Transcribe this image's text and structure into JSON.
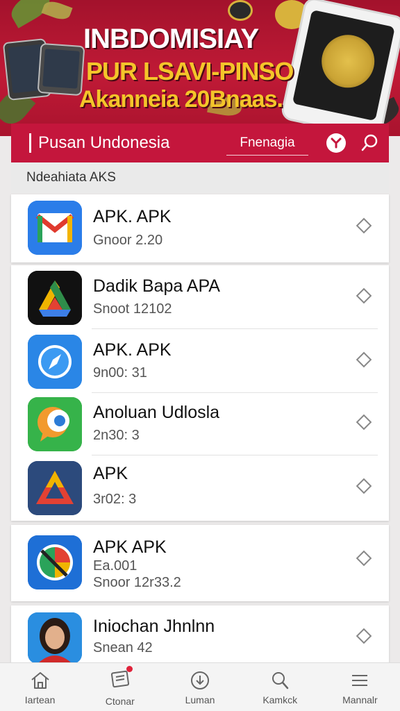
{
  "banner": {
    "line1": "INBDOMISIAY",
    "line2": "PUR LSAVI-PINSO",
    "line3": "Akanneia 20Bnaas."
  },
  "header": {
    "title": "Pusan Undonesia",
    "search_label": "Fnenagia"
  },
  "section": {
    "title": "Ndeahiata AKS"
  },
  "apps": [
    {
      "name": "APK. APK",
      "sub": "Gnoor 2.20"
    },
    {
      "name": "Dadik Bapa APA",
      "sub": "Snoot 12102"
    },
    {
      "name": "APK. APK",
      "sub": "9n00: 31"
    },
    {
      "name": "Anoluan Udlosla",
      "sub": "2n30: 3"
    },
    {
      "name": "APK",
      "sub": "3r02: 3"
    },
    {
      "name": "APK APK",
      "sub": "Ea.001",
      "sub2": "Snoor 12r33.2"
    },
    {
      "name": "Iniochan Jhnlnn",
      "sub": "Snean 42"
    }
  ],
  "nav": [
    {
      "label": "Iartean",
      "icon": "home-icon"
    },
    {
      "label": "Ctonar",
      "icon": "news-icon"
    },
    {
      "label": "Luman",
      "icon": "download-icon"
    },
    {
      "label": "Kamkck",
      "icon": "search-icon"
    },
    {
      "label": "Mannalr",
      "icon": "menu-icon"
    }
  ],
  "colors": {
    "brand": "#c4163c",
    "banner_text_yellow": "#f4c52a"
  }
}
